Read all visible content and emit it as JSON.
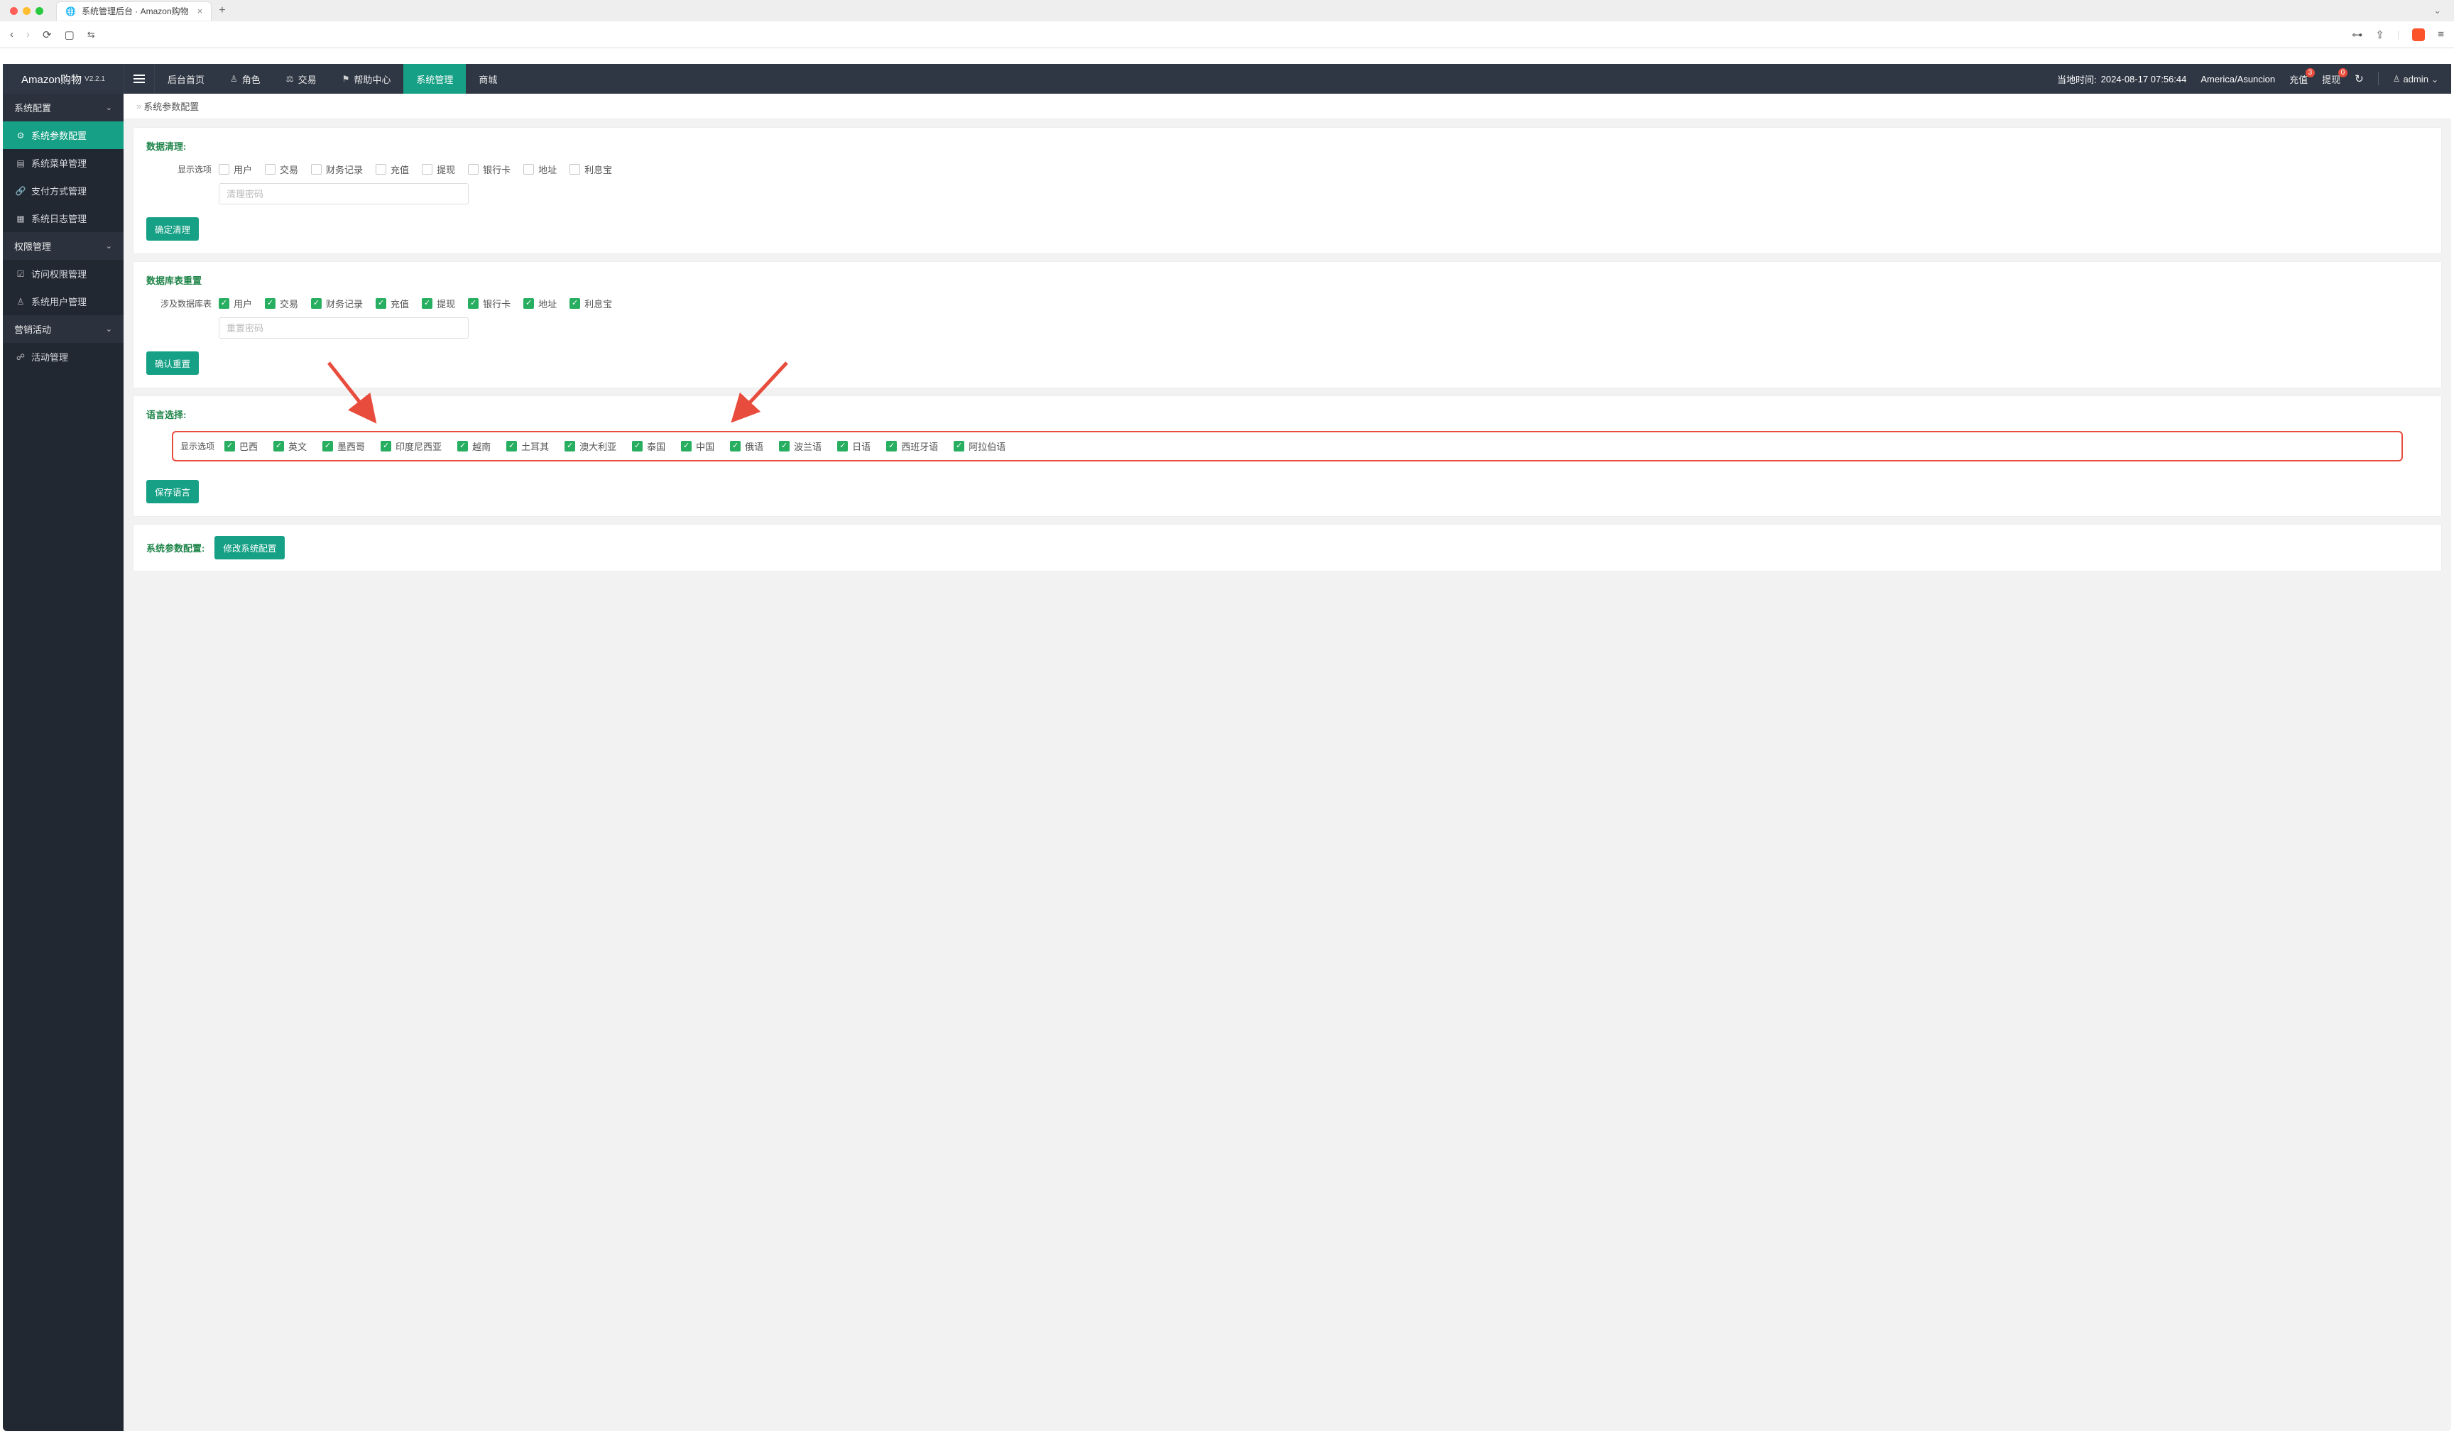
{
  "browser": {
    "tab_title": "系统管理后台 · Amazon购物"
  },
  "brand": {
    "name": "Amazon购物",
    "version": "V2.2.1"
  },
  "topnav": [
    {
      "label": "后台首页",
      "icon": ""
    },
    {
      "label": "角色",
      "icon": "user"
    },
    {
      "label": "交易",
      "icon": "scale"
    },
    {
      "label": "帮助中心",
      "icon": "flag"
    },
    {
      "label": "系统管理",
      "icon": "",
      "active": true
    },
    {
      "label": "商城",
      "icon": ""
    }
  ],
  "status": {
    "time_label": "当地时间:",
    "time_value": "2024-08-17 07:56:44",
    "tz": "America/Asuncion",
    "recharge": {
      "label": "充值",
      "badge": "3"
    },
    "withdraw": {
      "label": "提现",
      "badge": "0"
    },
    "user": "admin"
  },
  "sidebar": [
    {
      "type": "group",
      "label": "系统配置",
      "open": true,
      "items": [
        {
          "label": "系统参数配置",
          "icon": "gear",
          "active": true
        },
        {
          "label": "系统菜单管理",
          "icon": "menu"
        },
        {
          "label": "支付方式管理",
          "icon": "link"
        },
        {
          "label": "系统日志管理",
          "icon": "log"
        }
      ]
    },
    {
      "type": "group",
      "label": "权限管理",
      "open": true,
      "items": [
        {
          "label": "访问权限管理",
          "icon": "shield"
        },
        {
          "label": "系统用户管理",
          "icon": "user"
        }
      ]
    },
    {
      "type": "group",
      "label": "营销活动",
      "open": true,
      "items": [
        {
          "label": "活动管理",
          "icon": "link"
        }
      ]
    }
  ],
  "breadcrumb": "系统参数配置",
  "sections": {
    "clean": {
      "title": "数据清理:",
      "row_label": "显示选项",
      "options": [
        "用户",
        "交易",
        "财务记录",
        "充值",
        "提现",
        "银行卡",
        "地址",
        "利息宝"
      ],
      "password_placeholder": "清理密码",
      "button": "确定清理"
    },
    "reset": {
      "title": "数据库表重置",
      "row_label": "涉及数据库表",
      "options": [
        "用户",
        "交易",
        "财务记录",
        "充值",
        "提现",
        "银行卡",
        "地址",
        "利息宝"
      ],
      "password_placeholder": "重置密码",
      "button": "确认重置"
    },
    "lang": {
      "title": "语言选择:",
      "row_label": "显示选项",
      "options": [
        "巴西",
        "英文",
        "墨西哥",
        "印度尼西亚",
        "越南",
        "土耳其",
        "澳大利亚",
        "泰国",
        "中国",
        "俄语",
        "波兰语",
        "日语",
        "西班牙语",
        "阿拉伯语"
      ],
      "button": "保存语言"
    },
    "params": {
      "title": "系统参数配置:",
      "button": "修改系统配置"
    }
  }
}
